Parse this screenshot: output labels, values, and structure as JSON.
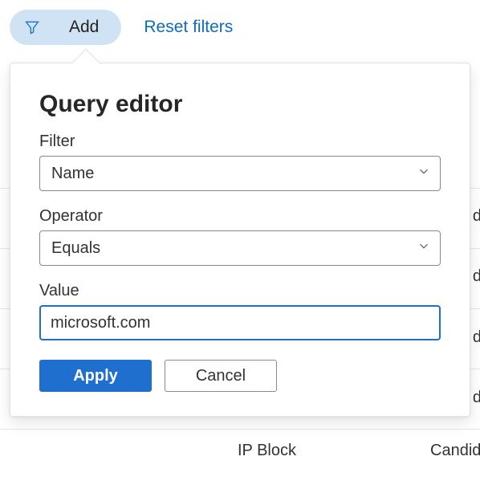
{
  "toolbar": {
    "add_label": "Add",
    "reset_label": "Reset filters"
  },
  "popover": {
    "title": "Query editor",
    "filter": {
      "label": "Filter",
      "selected": "Name"
    },
    "operator": {
      "label": "Operator",
      "selected": "Equals"
    },
    "value": {
      "label": "Value",
      "input": "microsoft.com"
    },
    "apply_label": "Apply",
    "cancel_label": "Cancel"
  },
  "background": {
    "col_ip_block": "IP Block",
    "col_candidate_partial": "Candid",
    "row_edge_d": "d"
  }
}
